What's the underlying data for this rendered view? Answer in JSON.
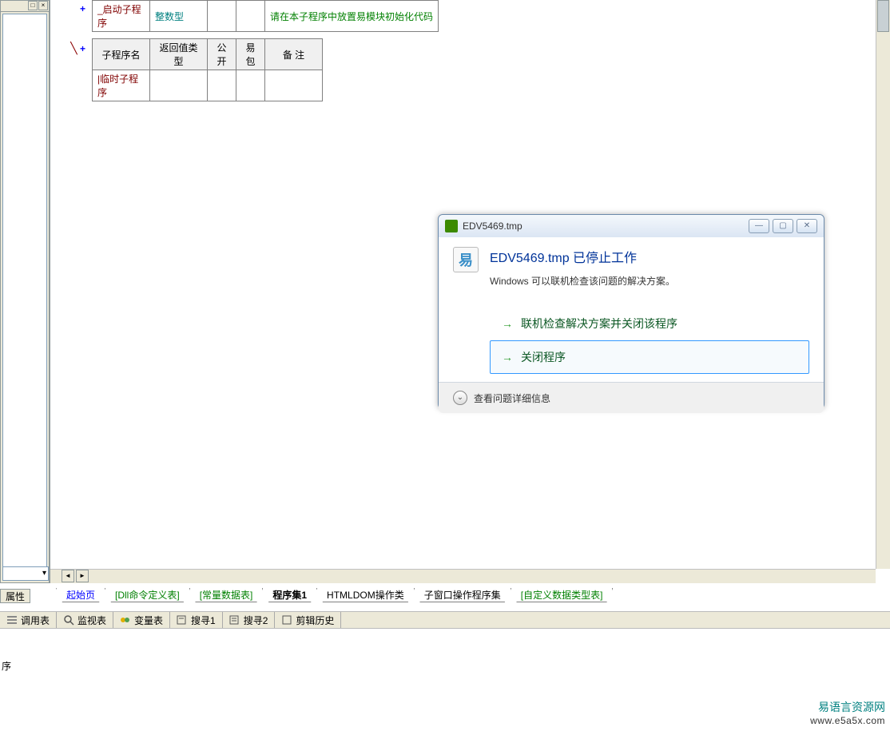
{
  "leftPanel": {
    "propsTab": "属性"
  },
  "editor": {
    "row1": {
      "name": "_启动子程序",
      "type": "整数型",
      "remark": "请在本子程序中放置易模块初始化代码"
    },
    "headers": {
      "name": "子程序名",
      "retType": "返回值类型",
      "public": "公开",
      "pkg": "易包",
      "remark": "备 注"
    },
    "row2": {
      "name": "|临时子程序"
    }
  },
  "docTabs": {
    "t0": "起始页",
    "t1": "[Dll命令定义表]",
    "t2": "[常量数据表]",
    "t3": "程序集1",
    "t4": "HTMLDOM操作类",
    "t5": "子窗口操作程序集",
    "t6": "[自定义数据类型表]"
  },
  "toolbar": {
    "callTable": "调用表",
    "watchTable": "监视表",
    "varTable": "变量表",
    "search1": "搜寻1",
    "search2": "搜寻2",
    "clipHistory": "剪辑历史"
  },
  "statusLine": "序",
  "watermark": {
    "line1": "易语言资源网",
    "line2": "www.e5a5x.com"
  },
  "dialog": {
    "title": "EDV5469.tmp",
    "heading": "EDV5469.tmp 已停止工作",
    "subtext": "Windows 可以联机检查该问题的解决方案。",
    "opt1": "联机检查解决方案并关闭该程序",
    "opt2": "关闭程序",
    "footer": "查看问题详细信息"
  }
}
